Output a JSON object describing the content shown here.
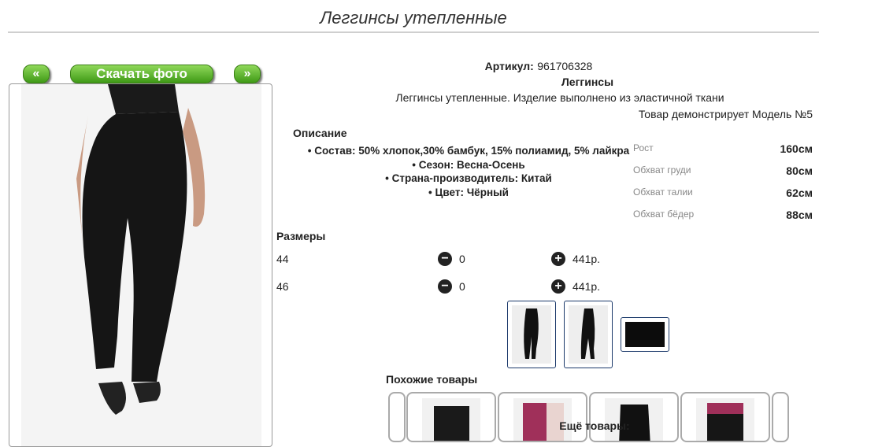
{
  "page": {
    "title": "Леггинсы утепленные"
  },
  "gallery": {
    "prev_label": "«",
    "download_label": "Скачать фото",
    "next_label": "»"
  },
  "product": {
    "article_label": "Артикул:",
    "article_value": "961706328",
    "name": "Леггинсы",
    "short_description": "Леггинсы утепленные. Изделие выполнено из эластичной ткани",
    "model_note": "Товар демонстрирует Модель №5"
  },
  "description": {
    "heading": "Описание",
    "items": [
      "Состав: 50% хлопок,30% бамбук, 15% полиамид, 5% лайкра",
      "Сезон: Весна-Осень",
      "Страна-производитель: Китай",
      "Цвет: Чёрный"
    ]
  },
  "measurements": [
    {
      "label": "Рост",
      "value": "160см"
    },
    {
      "label": "Обхват груди",
      "value": "80см"
    },
    {
      "label": "Обхват талии",
      "value": "62см"
    },
    {
      "label": "Обхват бёдер",
      "value": "88см"
    }
  ],
  "sizes": {
    "heading": "Размеры",
    "rows": [
      {
        "size": "44",
        "qty": "0",
        "price": "441р."
      },
      {
        "size": "46",
        "qty": "0",
        "price": "441р."
      }
    ]
  },
  "similar": {
    "heading": "Похожие товары"
  },
  "more": {
    "heading": "Ещё товары:"
  },
  "icons": {
    "minus": "minus-circle-icon",
    "plus": "plus-circle-icon"
  },
  "colors": {
    "button_green": "#4caf1f",
    "thumb_border": "#1c3a6b"
  }
}
